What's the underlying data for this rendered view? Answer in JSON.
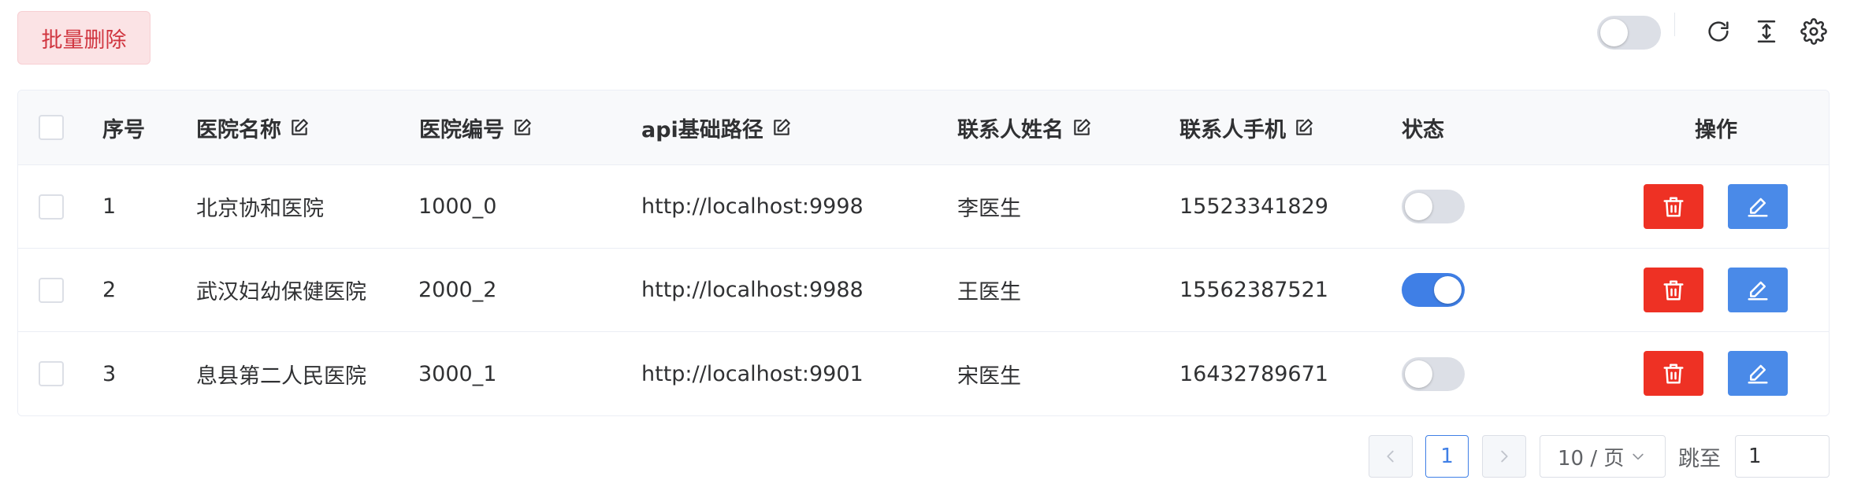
{
  "toolbar": {
    "batch_delete_label": "批量删除",
    "icons": [
      "refresh-icon",
      "column-height-icon",
      "settings-icon"
    ]
  },
  "table": {
    "headers": {
      "index": "序号",
      "hospital_name": "医院名称",
      "hospital_code": "医院编号",
      "api_path": "api基础路径",
      "contact_name": "联系人姓名",
      "contact_phone": "联系人手机",
      "status": "状态",
      "actions": "操作"
    },
    "rows": [
      {
        "index": "1",
        "hospital_name": "北京协和医院",
        "hospital_code": "1000_0",
        "api_path": "http://localhost:9998",
        "contact_name": "李医生",
        "contact_phone": "15523341829",
        "status_on": false
      },
      {
        "index": "2",
        "hospital_name": "武汉妇幼保健医院",
        "hospital_code": "2000_2",
        "api_path": "http://localhost:9988",
        "contact_name": "王医生",
        "contact_phone": "15562387521",
        "status_on": true
      },
      {
        "index": "3",
        "hospital_name": "息县第二人民医院",
        "hospital_code": "3000_1",
        "api_path": "http://localhost:9901",
        "contact_name": "宋医生",
        "contact_phone": "16432789671",
        "status_on": false
      }
    ]
  },
  "pagination": {
    "current_page": "1",
    "page_size": "10 / 页",
    "jump_label": "跳至",
    "jump_value": "1"
  },
  "colors": {
    "primary": "#3f7fe6",
    "danger": "#ee3124",
    "edit": "#4a8ae8"
  }
}
